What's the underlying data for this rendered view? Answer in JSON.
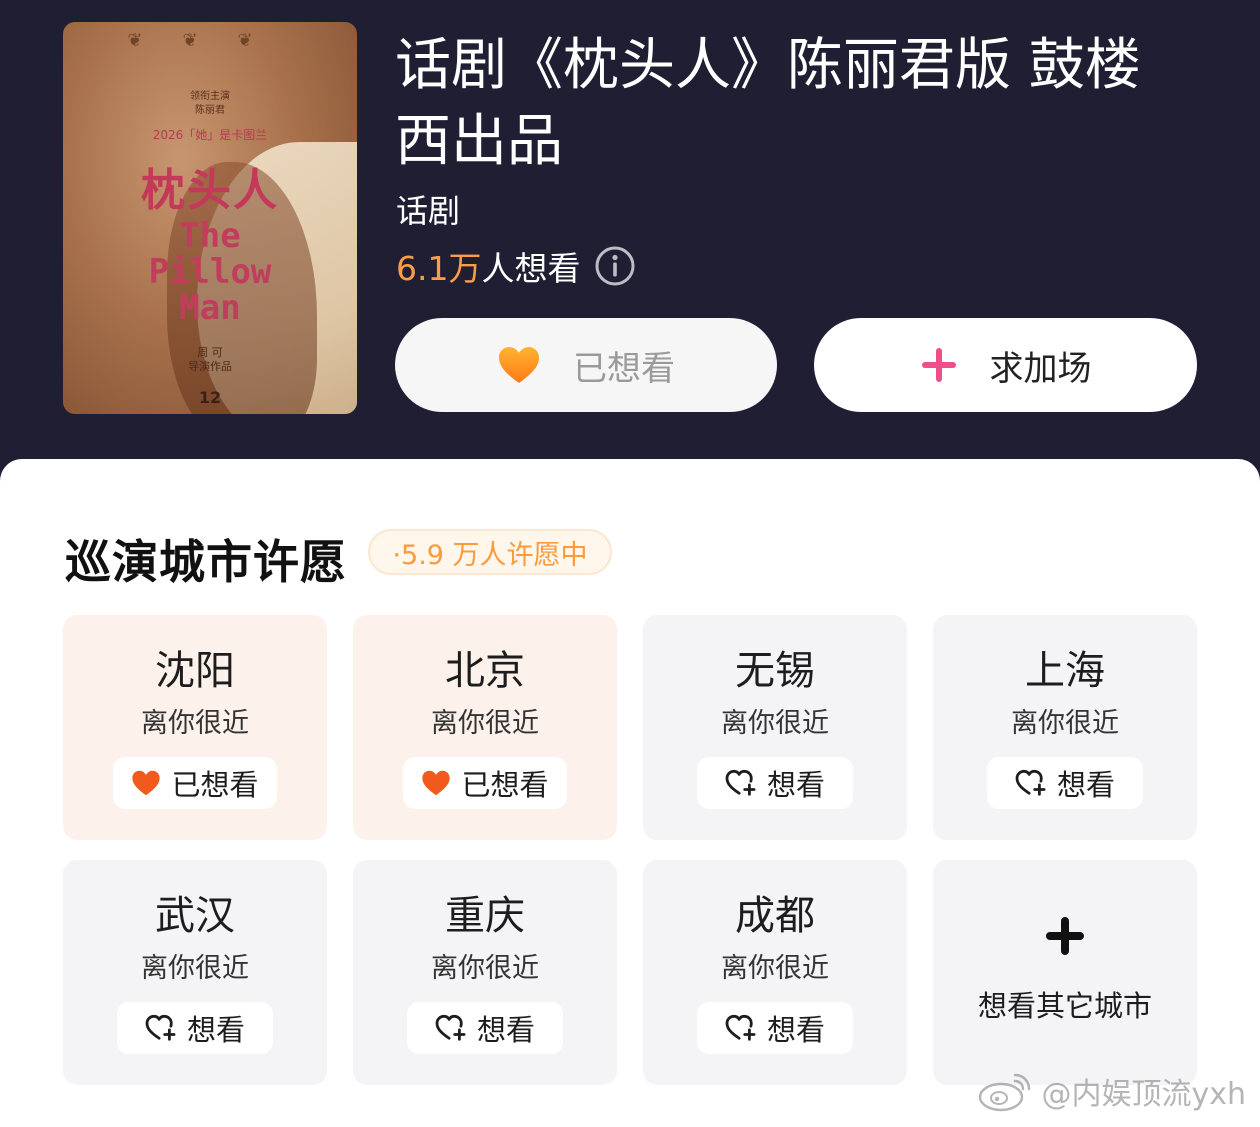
{
  "show": {
    "title": "话剧《枕头人》陈丽君版 鼓楼西出品",
    "category": "话剧",
    "want_count": "6.1万",
    "want_suffix": "人想看",
    "poster": {
      "credit_top": "领衔主演\n陈丽君",
      "tag": "2026「她」是卡图兰",
      "cn_title": "枕头人",
      "en_title": "The Pillow Man",
      "director": "周 可\n导演作品",
      "anniversary": "12"
    }
  },
  "actions": {
    "wanted_label": "已想看",
    "add_label": "求加场"
  },
  "tour": {
    "title": "巡演城市许愿",
    "wish_count": "·5.9 万人许愿中",
    "cities": [
      {
        "name": "沈阳",
        "distance": "离你很近",
        "state": "已想看",
        "wanted": true
      },
      {
        "name": "北京",
        "distance": "离你很近",
        "state": "已想看",
        "wanted": true
      },
      {
        "name": "无锡",
        "distance": "离你很近",
        "state": "想看",
        "wanted": false
      },
      {
        "name": "上海",
        "distance": "离你很近",
        "state": "想看",
        "wanted": false
      },
      {
        "name": "武汉",
        "distance": "离你很近",
        "state": "想看",
        "wanted": false
      },
      {
        "name": "重庆",
        "distance": "离你很近",
        "state": "想看",
        "wanted": false
      },
      {
        "name": "成都",
        "distance": "离你很近",
        "state": "想看",
        "wanted": false
      }
    ],
    "other_label": "想看其它城市"
  },
  "watermark": "@内娱顶流yxh",
  "colors": {
    "header_bg": "#1f1e33",
    "accent_orange": "#ff9d45",
    "heart_orange": "#f25a1d",
    "plus_pink": "#f04e8a",
    "wanted_card_bg": "#fdf1ec",
    "card_bg": "#f4f4f6"
  },
  "icons": {
    "info": "info-icon",
    "wanted": "heart-filled-icon",
    "add": "plus-icon",
    "want": "heart-plus-icon",
    "other": "plus-icon",
    "watermark": "weibo-icon"
  }
}
